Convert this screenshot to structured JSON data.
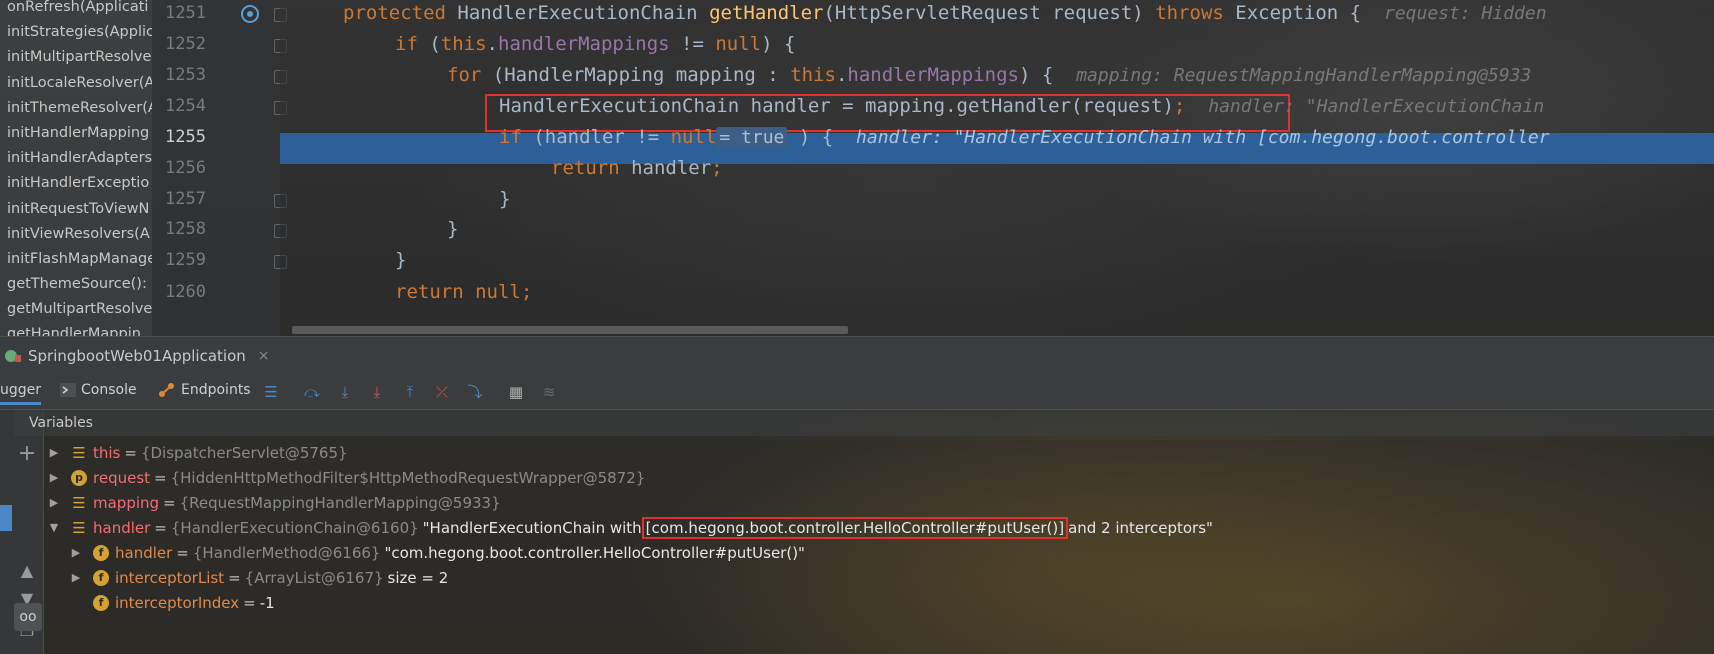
{
  "structure": {
    "items": [
      "onRefresh(Applicati",
      "initStrategies(Applic",
      "initMultipartResolve",
      "initLocaleResolver(A",
      "initThemeResolver(A",
      "initHandlerMapping",
      "initHandlerAdapters",
      "initHandlerExceptio",
      "initRequestToViewN",
      "initViewResolvers(A",
      "initFlashMapManage",
      "getThemeSource():",
      "getMultipartResolve",
      "getHandlerMappin"
    ]
  },
  "gutter": {
    "line_numbers": [
      "1251",
      "1252",
      "1253",
      "1254",
      "1255",
      "1256",
      "1257",
      "1258",
      "1259",
      "1260"
    ]
  },
  "code": {
    "l1251": {
      "kw1": "protected ",
      "type": "HandlerExecutionChain ",
      "fn": "getHandler",
      "rest": "(HttpServletRequest request) ",
      "kw2": "throws ",
      "rest2": "Exception {  ",
      "hint": "request: Hidden"
    },
    "l1252": {
      "kw1": "if ",
      "p1": "(",
      "kw2": "this",
      "p2": ".",
      "fld": "handlerMappings",
      "p3": " != ",
      "kw3": "null",
      "p4": ") {"
    },
    "l1253": {
      "kw1": "for ",
      "p1": "(HandlerMapping mapping : ",
      "kw2": "this",
      "p2": ".",
      "fld": "handlerMappings",
      "p3": ") {  ",
      "hint": "mapping: RequestMappingHandlerMapping@5933"
    },
    "l1254": {
      "text": "HandlerExecutionChain handler = mapping.getHandler(request)",
      "semi": ";",
      "hint": "handler: \"HandlerExecutionChain"
    },
    "l1255": {
      "kw1": "if ",
      "p1": "(handler != ",
      "kw2": "null",
      "inlay": "= true",
      "p2": " ) {  ",
      "hint": "handler: \"HandlerExecutionChain with [com.hegong.boot.controller"
    },
    "l1256": {
      "kw1": "return ",
      "p1": "handler",
      "semi": ";"
    },
    "l1257": {
      "text": "}"
    },
    "l1258": {
      "text": "}"
    },
    "l1259": {
      "text": "}"
    },
    "l1260": {
      "kw1": "return ",
      "kw2": "null",
      "semi": ";"
    }
  },
  "run_tab": {
    "label": "SpringbootWeb01Application",
    "close": "×"
  },
  "toolbar": {
    "debugger_tab": "ugger",
    "console_tab": "Console",
    "endpoints_tab": "Endpoints"
  },
  "variables": {
    "header": "Variables",
    "rows": [
      {
        "name": "this",
        "eq": " = ",
        "type": "{DispatcherServlet@5765}",
        "value": ""
      },
      {
        "name": "request",
        "eq": " = ",
        "type": "{HiddenHttpMethodFilter$HttpMethodRequestWrapper@5872}",
        "value": ""
      },
      {
        "name": "mapping",
        "eq": " = ",
        "type": "{RequestMappingHandlerMapping@5933}",
        "value": ""
      },
      {
        "name": "handler",
        "eq": " = ",
        "type": "{HandlerExecutionChain@6160}",
        "value_pre": "\"HandlerExecutionChain with ",
        "value_boxed": "[com.hegong.boot.controller.HelloController#putUser()]",
        "value_post": " and 2 interceptors\""
      },
      {
        "name": "handler",
        "eq": " = ",
        "type": "{HandlerMethod@6166}",
        "value": "\"com.hegong.boot.controller.HelloController#putUser()\""
      },
      {
        "name": "interceptorList",
        "eq": " = ",
        "type": "{ArrayList@6167}",
        "value": " size = 2"
      },
      {
        "name": "interceptorIndex",
        "eq": " = ",
        "type": "",
        "value": "-1"
      }
    ]
  },
  "icons": [
    "breakpoint-icon",
    "spring-icon",
    "console-icon",
    "endpoints-icon",
    "menu-icon",
    "step-over-icon",
    "step-into-icon",
    "force-step-into-icon",
    "step-out-icon",
    "drop-frame-icon",
    "run-to-cursor-icon",
    "evaluate-icon",
    "trace-icon",
    "add-watch-icon",
    "glasses-icon"
  ],
  "colors": {
    "current_line": "#2d6099",
    "highlight_box": "#e03030",
    "keyword": "#cc7832",
    "method": "#ffc66d",
    "field": "#9876aa"
  }
}
